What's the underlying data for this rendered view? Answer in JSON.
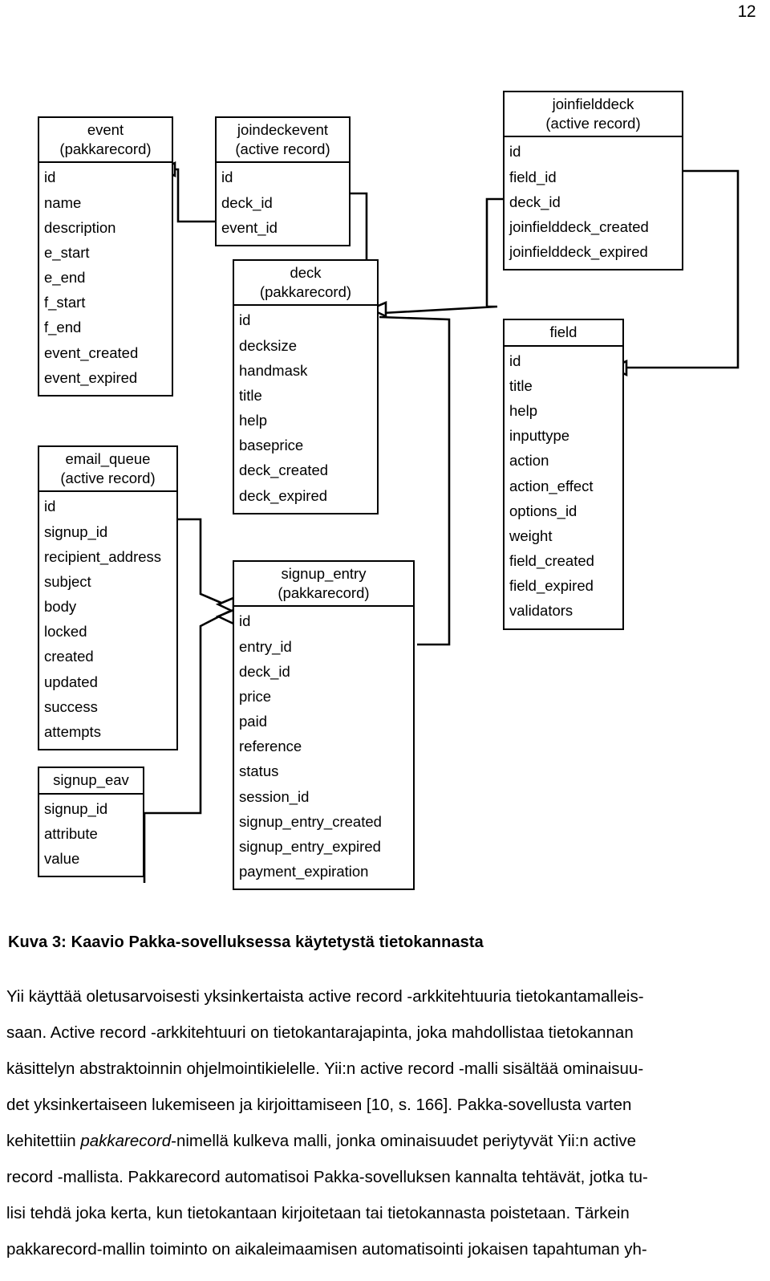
{
  "page": {
    "number": "12"
  },
  "figure": {
    "caption": "Kuva 3: Kaavio Pakka-sovelluksessa käytetystä tietokannasta",
    "entities": [
      {
        "id": "event",
        "title": "event",
        "subtitle": "(pakkarecord)",
        "attributes": [
          "id",
          "name",
          "description",
          "e_start",
          "e_end",
          "f_start",
          "f_end",
          "event_created",
          "event_expired"
        ]
      },
      {
        "id": "joindeckevent",
        "title": "joindeckevent",
        "subtitle": "(active record)",
        "attributes": [
          "id",
          "deck_id",
          "event_id"
        ]
      },
      {
        "id": "joinfielddeck",
        "title": "joinfielddeck",
        "subtitle": "(active record)",
        "attributes": [
          "id",
          "field_id",
          "deck_id",
          "joinfielddeck_created",
          "joinfielddeck_expired"
        ]
      },
      {
        "id": "deck",
        "title": "deck",
        "subtitle": "(pakkarecord)",
        "attributes": [
          "id",
          "decksize",
          "handmask",
          "title",
          "help",
          "baseprice",
          "deck_created",
          "deck_expired"
        ]
      },
      {
        "id": "field",
        "title": "field",
        "subtitle": "",
        "attributes": [
          "id",
          "title",
          "help",
          "inputtype",
          "action",
          "action_effect",
          "options_id",
          "weight",
          "field_created",
          "field_expired",
          "validators"
        ]
      },
      {
        "id": "email_queue",
        "title": "email_queue",
        "subtitle": "(active record)",
        "attributes": [
          "id",
          "signup_id",
          "recipient_address",
          "subject",
          "body",
          "locked",
          "created",
          "updated",
          "success",
          "attempts"
        ]
      },
      {
        "id": "signup_entry",
        "title": "signup_entry",
        "subtitle": "(pakkarecord)",
        "attributes": [
          "id",
          "entry_id",
          "deck_id",
          "price",
          "paid",
          "reference",
          "status",
          "session_id",
          "signup_entry_created",
          "signup_entry_expired",
          "payment_expiration"
        ]
      },
      {
        "id": "signup_eav",
        "title": "signup_eav",
        "subtitle": "",
        "attributes": [
          "signup_id",
          "attribute",
          "value"
        ]
      }
    ]
  },
  "body": {
    "paragraph_lines": [
      "Yii käyttää oletusarvoisesti yksinkertaista active record -arkkitehtuuria tietokantamalleis-",
      "saan. Active record -arkkitehtuuri on tietokantarajapinta, joka mahdollistaa tietokannan",
      "käsittelyn abstraktoinnin ohjelmointikielelle. Yii:n active record -malli sisältää ominaisuu-",
      "det yksinkertaiseen lukemiseen ja kirjoittamiseen [10, s. 166]. Pakka-sovellusta varten",
      "kehitettiin pakkarecord-nimellä kulkeva malli, jonka ominaisuudet periytyvät Yii:n active",
      "record -mallista. Pakkarecord automatisoi Pakka-sovelluksen kannalta tehtävät, jotka tu-",
      "lisi tehdä joka kerta, kun tietokantaan kirjoitetaan tai tietokannasta poistetaan. Tärkein",
      "pakkarecord-mallin toiminto on aikaleimaamisen automatisointi jokaisen tapahtuman yh-"
    ],
    "italic_term": "pakkarecord"
  }
}
